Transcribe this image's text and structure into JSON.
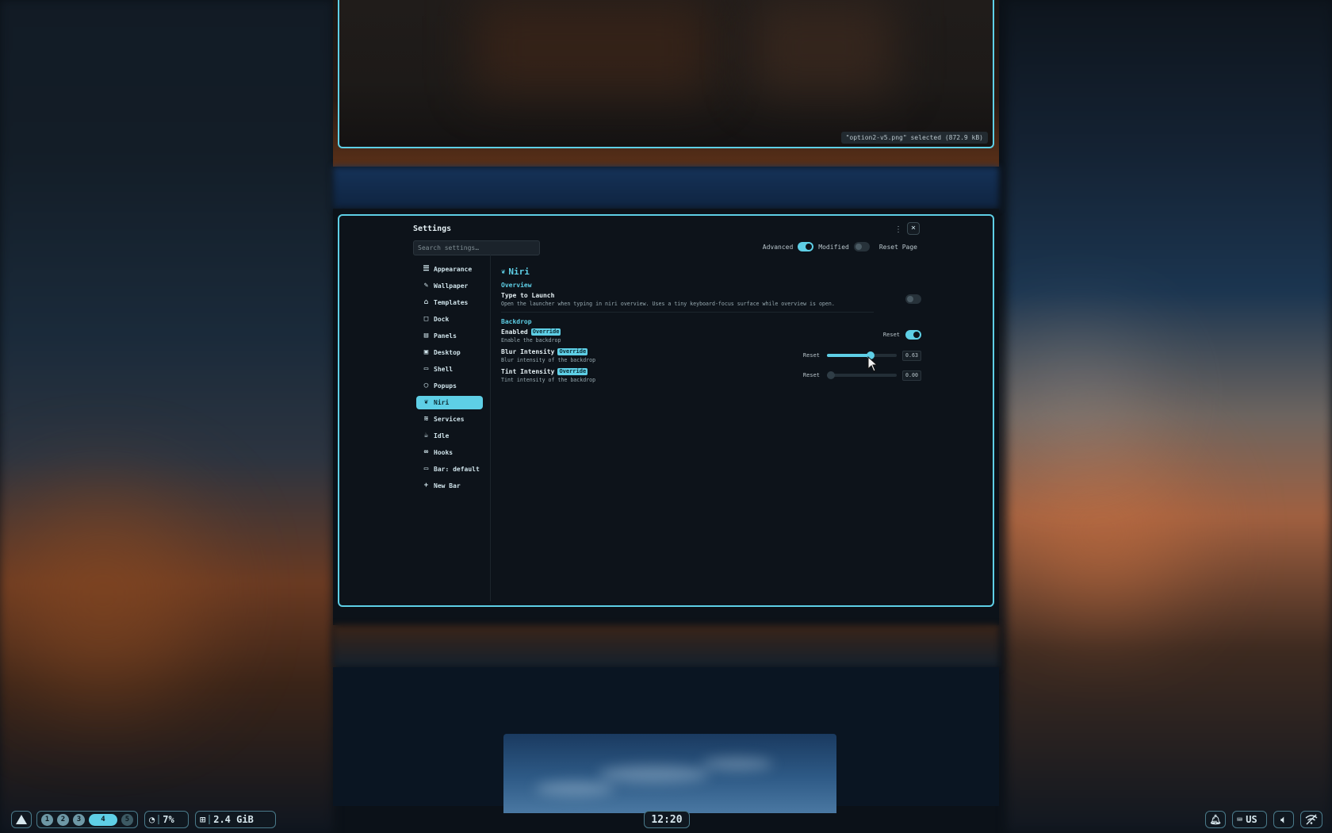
{
  "top_window": {
    "status": "\"option2-v5.png\" selected (872.9 kB)"
  },
  "settings": {
    "title": "Settings",
    "menu_glyph": "⋮",
    "close_glyph": "×",
    "search_placeholder": "Search settings…",
    "advanced_label": "Advanced",
    "advanced_on": true,
    "modified_label": "Modified",
    "modified_on": false,
    "reset_page_label": "Reset Page",
    "sidebar": [
      {
        "label": "Appearance",
        "icon": "sliders-icon",
        "glyph": "☰"
      },
      {
        "label": "Wallpaper",
        "icon": "brush-icon",
        "glyph": "✎"
      },
      {
        "label": "Templates",
        "icon": "template-icon",
        "glyph": "⌂"
      },
      {
        "label": "Dock",
        "icon": "dock-icon",
        "glyph": "□"
      },
      {
        "label": "Panels",
        "icon": "panels-icon",
        "glyph": "▤"
      },
      {
        "label": "Desktop",
        "icon": "desktop-icon",
        "glyph": "▣"
      },
      {
        "label": "Shell",
        "icon": "shell-icon",
        "glyph": "▭"
      },
      {
        "label": "Popups",
        "icon": "popup-icon",
        "glyph": "◯"
      },
      {
        "label": "Niri",
        "icon": "niri-icon",
        "glyph": "❦",
        "active": true
      },
      {
        "label": "Services",
        "icon": "layers-icon",
        "glyph": "≋"
      },
      {
        "label": "Idle",
        "icon": "idle-icon",
        "glyph": "☕"
      },
      {
        "label": "Hooks",
        "icon": "link-icon",
        "glyph": "∞"
      },
      {
        "label": "Bar: default",
        "icon": "bar-icon",
        "glyph": "▭"
      },
      {
        "label": "New Bar",
        "icon": "plus-icon",
        "glyph": "+"
      }
    ],
    "page": {
      "title": "Niri",
      "overview": {
        "heading": "Overview",
        "type_to_launch": {
          "label": "Type to Launch",
          "desc": "Open the launcher when typing in niri overview. Uses a tiny keyboard-focus surface while overview is open.",
          "on": false
        }
      },
      "backdrop": {
        "heading": "Backdrop",
        "enabled": {
          "label": "Enabled",
          "badge": "Override",
          "desc": "Enable the backdrop",
          "reset": "Reset",
          "on": true
        },
        "blur": {
          "label": "Blur Intensity",
          "badge": "Override",
          "desc": "Blur intensity of the backdrop",
          "reset": "Reset",
          "value": 0.63,
          "value_text": "0.63"
        },
        "tint": {
          "label": "Tint Intensity",
          "badge": "Override",
          "desc": "Tint intensity of the backdrop",
          "reset": "Reset",
          "value": 0.0,
          "value_text": "0.00"
        }
      }
    }
  },
  "taskbar": {
    "workspaces": [
      {
        "label": "1",
        "state": "normal"
      },
      {
        "label": "2",
        "state": "normal"
      },
      {
        "label": "3",
        "state": "normal"
      },
      {
        "label": "4",
        "state": "active"
      },
      {
        "label": "5",
        "state": "dim"
      }
    ],
    "cpu": "7%",
    "memory": "2.4 GiB",
    "clock": "12:20",
    "keyboard_layout": "US"
  }
}
